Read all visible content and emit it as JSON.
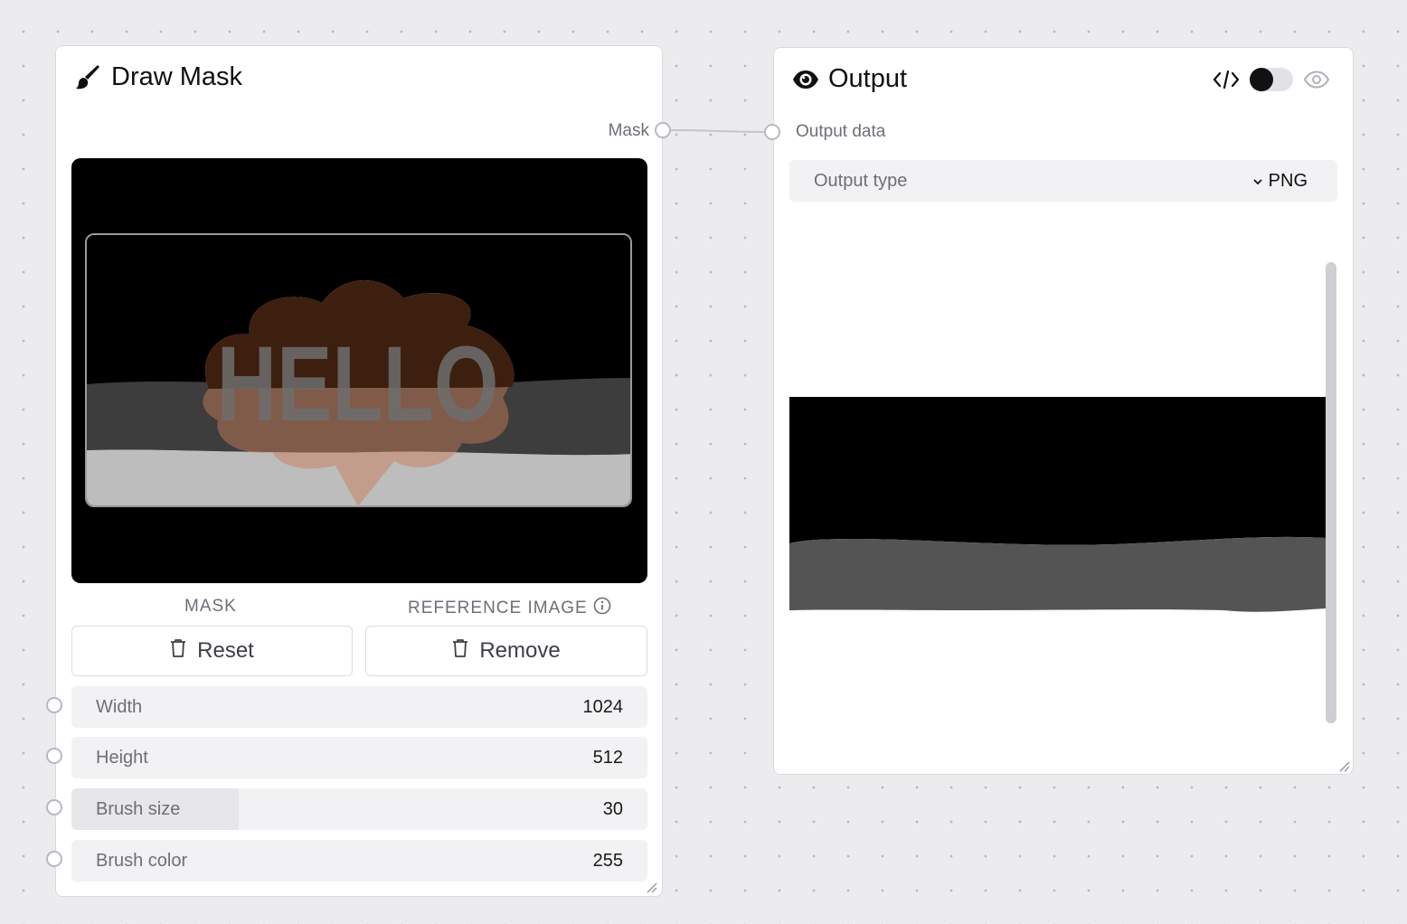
{
  "draw_mask_node": {
    "title": "Draw Mask",
    "title_icon": "paintbrush-icon",
    "output_port_label": "Mask",
    "canvas_text": "HELLO",
    "mask_section_label": "MASK",
    "reference_section_label": "REFERENCE IMAGE",
    "reset_button_label": "Reset",
    "remove_button_label": "Remove",
    "fields": [
      {
        "label": "Width",
        "value": "1024"
      },
      {
        "label": "Height",
        "value": "512"
      },
      {
        "label": "Brush size",
        "value": "30",
        "slider_fraction": 0.29
      },
      {
        "label": "Brush color",
        "value": "255"
      }
    ]
  },
  "output_node": {
    "title": "Output",
    "title_icon": "eye-icon",
    "input_port_label": "Output data",
    "output_type_label": "Output type",
    "output_type_value": "PNG",
    "toggle_on": false
  },
  "colors": {
    "canvas_background": "#000000",
    "bubble_brown": "#3d1f10",
    "mask_gray": "#545454",
    "mask_white": "#ffffff"
  }
}
